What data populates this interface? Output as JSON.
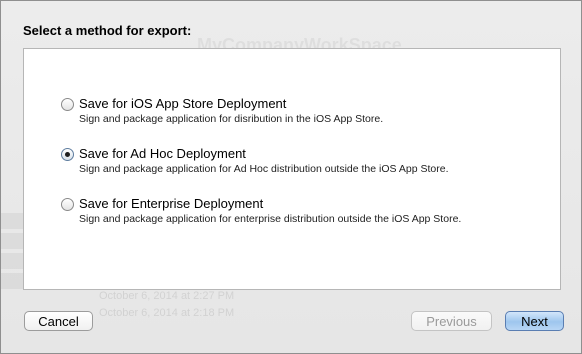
{
  "dialog": {
    "heading": "Select a method for export:",
    "options": [
      {
        "title": "Save for iOS App Store Deployment",
        "description": "Sign and package application for disribution in the iOS App Store.",
        "selected": false
      },
      {
        "title": "Save for Ad Hoc Deployment",
        "description": "Sign and package application for Ad Hoc distribution outside the iOS App Store.",
        "selected": true
      },
      {
        "title": "Save for Enterprise Deployment",
        "description": "Sign and package application for enterprise distribution outside the iOS App Store.",
        "selected": false
      }
    ],
    "buttons": {
      "cancel": "Cancel",
      "previous": "Previous",
      "next": "Next"
    }
  },
  "background": {
    "workspace_title": "MyCompanyWorkSpace",
    "rows": [
      "October 6, 2014 at 2:27 PM",
      "October 6, 2014 at 2:18 PM"
    ]
  },
  "colors": {
    "default_button": "#9ec6ee",
    "radio_selected_dot": "#1d1d1d",
    "panel": "#ffffff"
  }
}
